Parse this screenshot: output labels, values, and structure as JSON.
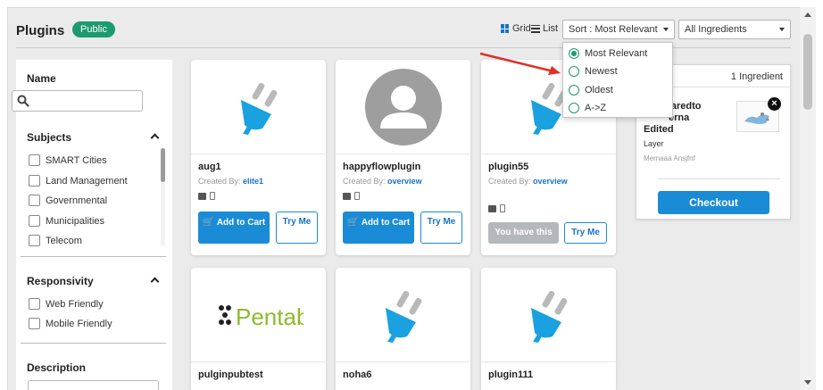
{
  "header": {
    "title": "Plugins",
    "badge": "Public",
    "view_grid": "Grid",
    "view_list": "List",
    "sort_value": "Sort : Most Relevant",
    "filter_value": "All Ingredients"
  },
  "sort_dropdown": {
    "options": [
      "Most Relevant",
      "Newest",
      "Oldest",
      "A->Z"
    ],
    "selected": "Most Relevant"
  },
  "sidebar": {
    "name_title": "Name",
    "subjects_title": "Subjects",
    "subjects": [
      "SMART Cities",
      "Land Management",
      "Governmental",
      "Municipalities",
      "Telecom"
    ],
    "responsivity_title": "Responsivity",
    "responsivity": [
      "Web Friendly",
      "Mobile Friendly"
    ],
    "description_title": "Description"
  },
  "cards": [
    {
      "name": "aug1",
      "created_by_label": "Created By:",
      "author": "elite1",
      "cart_label": "Add to Cart",
      "try_label": "Try Me",
      "image": "plug-icon"
    },
    {
      "name": "happyflowplugin",
      "created_by_label": "Created By:",
      "author": "overview",
      "cart_label": "Add to Cart",
      "try_label": "Try Me",
      "image": "avatar-placeholder"
    },
    {
      "name": "plugin55",
      "created_by_label": "Created By:",
      "author": "overview",
      "owned_label": "You have this",
      "try_label": "Try Me",
      "image": "plug-icon"
    },
    {
      "name": "pulginpubtest",
      "image": "pentab-logo",
      "logo_text": "Pentab"
    },
    {
      "name": "noha6",
      "image": "plug-icon"
    },
    {
      "name": "plugin111",
      "image": "plug-icon"
    }
  ],
  "cart": {
    "count": "1 Ingredient",
    "item_line1": "sharedto",
    "item_line2": "erna",
    "item_line3": "Edited",
    "item_type": "Layer",
    "item_author": "Mernaaa Ansjfnf",
    "checkout_label": "Checkout"
  },
  "colors": {
    "accent": "#1a8bd6",
    "badge": "#1c9a70",
    "arrow": "#e0302a"
  }
}
